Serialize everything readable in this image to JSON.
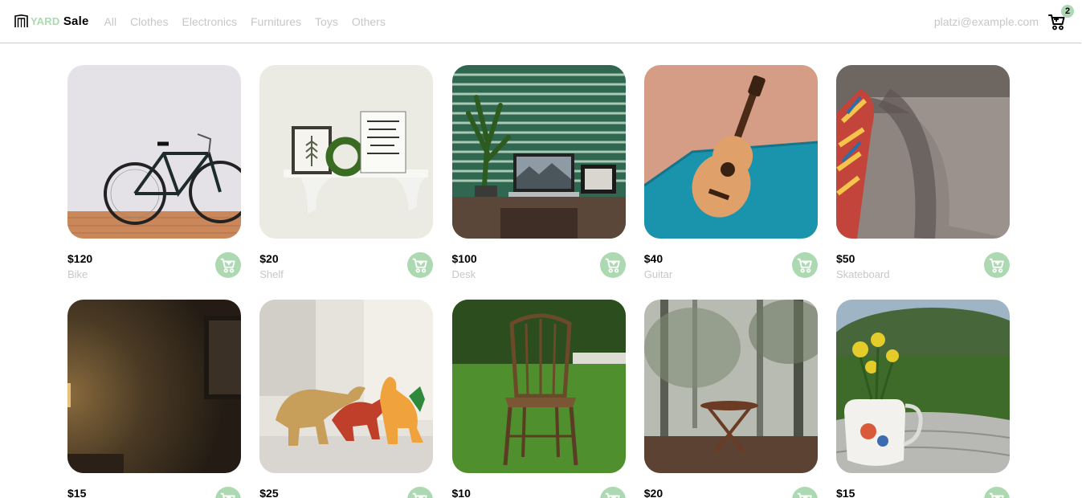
{
  "brand": {
    "word1": "YARD",
    "word2": "Sale"
  },
  "nav": {
    "categories": [
      "All",
      "Clothes",
      "Electronics",
      "Furnitures",
      "Toys",
      "Others"
    ],
    "email": "platzi@example.com",
    "cart_count": "2"
  },
  "colors": {
    "accent": "#acd9b2",
    "muted_text": "#c7c7c7",
    "border": "#c9c9c9"
  },
  "products": [
    {
      "price": "$120",
      "name": "Bike",
      "image": "bike"
    },
    {
      "price": "$20",
      "name": "Shelf",
      "image": "shelf"
    },
    {
      "price": "$100",
      "name": "Desk",
      "image": "desk"
    },
    {
      "price": "$40",
      "name": "Guitar",
      "image": "guitar"
    },
    {
      "price": "$50",
      "name": "Skateboard",
      "image": "skateboard"
    },
    {
      "price": "$15",
      "name": "",
      "image": "lamp-room"
    },
    {
      "price": "$25",
      "name": "",
      "image": "toy-dinosaurs"
    },
    {
      "price": "$10",
      "name": "",
      "image": "chair"
    },
    {
      "price": "$20",
      "name": "",
      "image": "forest-table"
    },
    {
      "price": "$15",
      "name": "",
      "image": "flower-pitcher"
    }
  ]
}
